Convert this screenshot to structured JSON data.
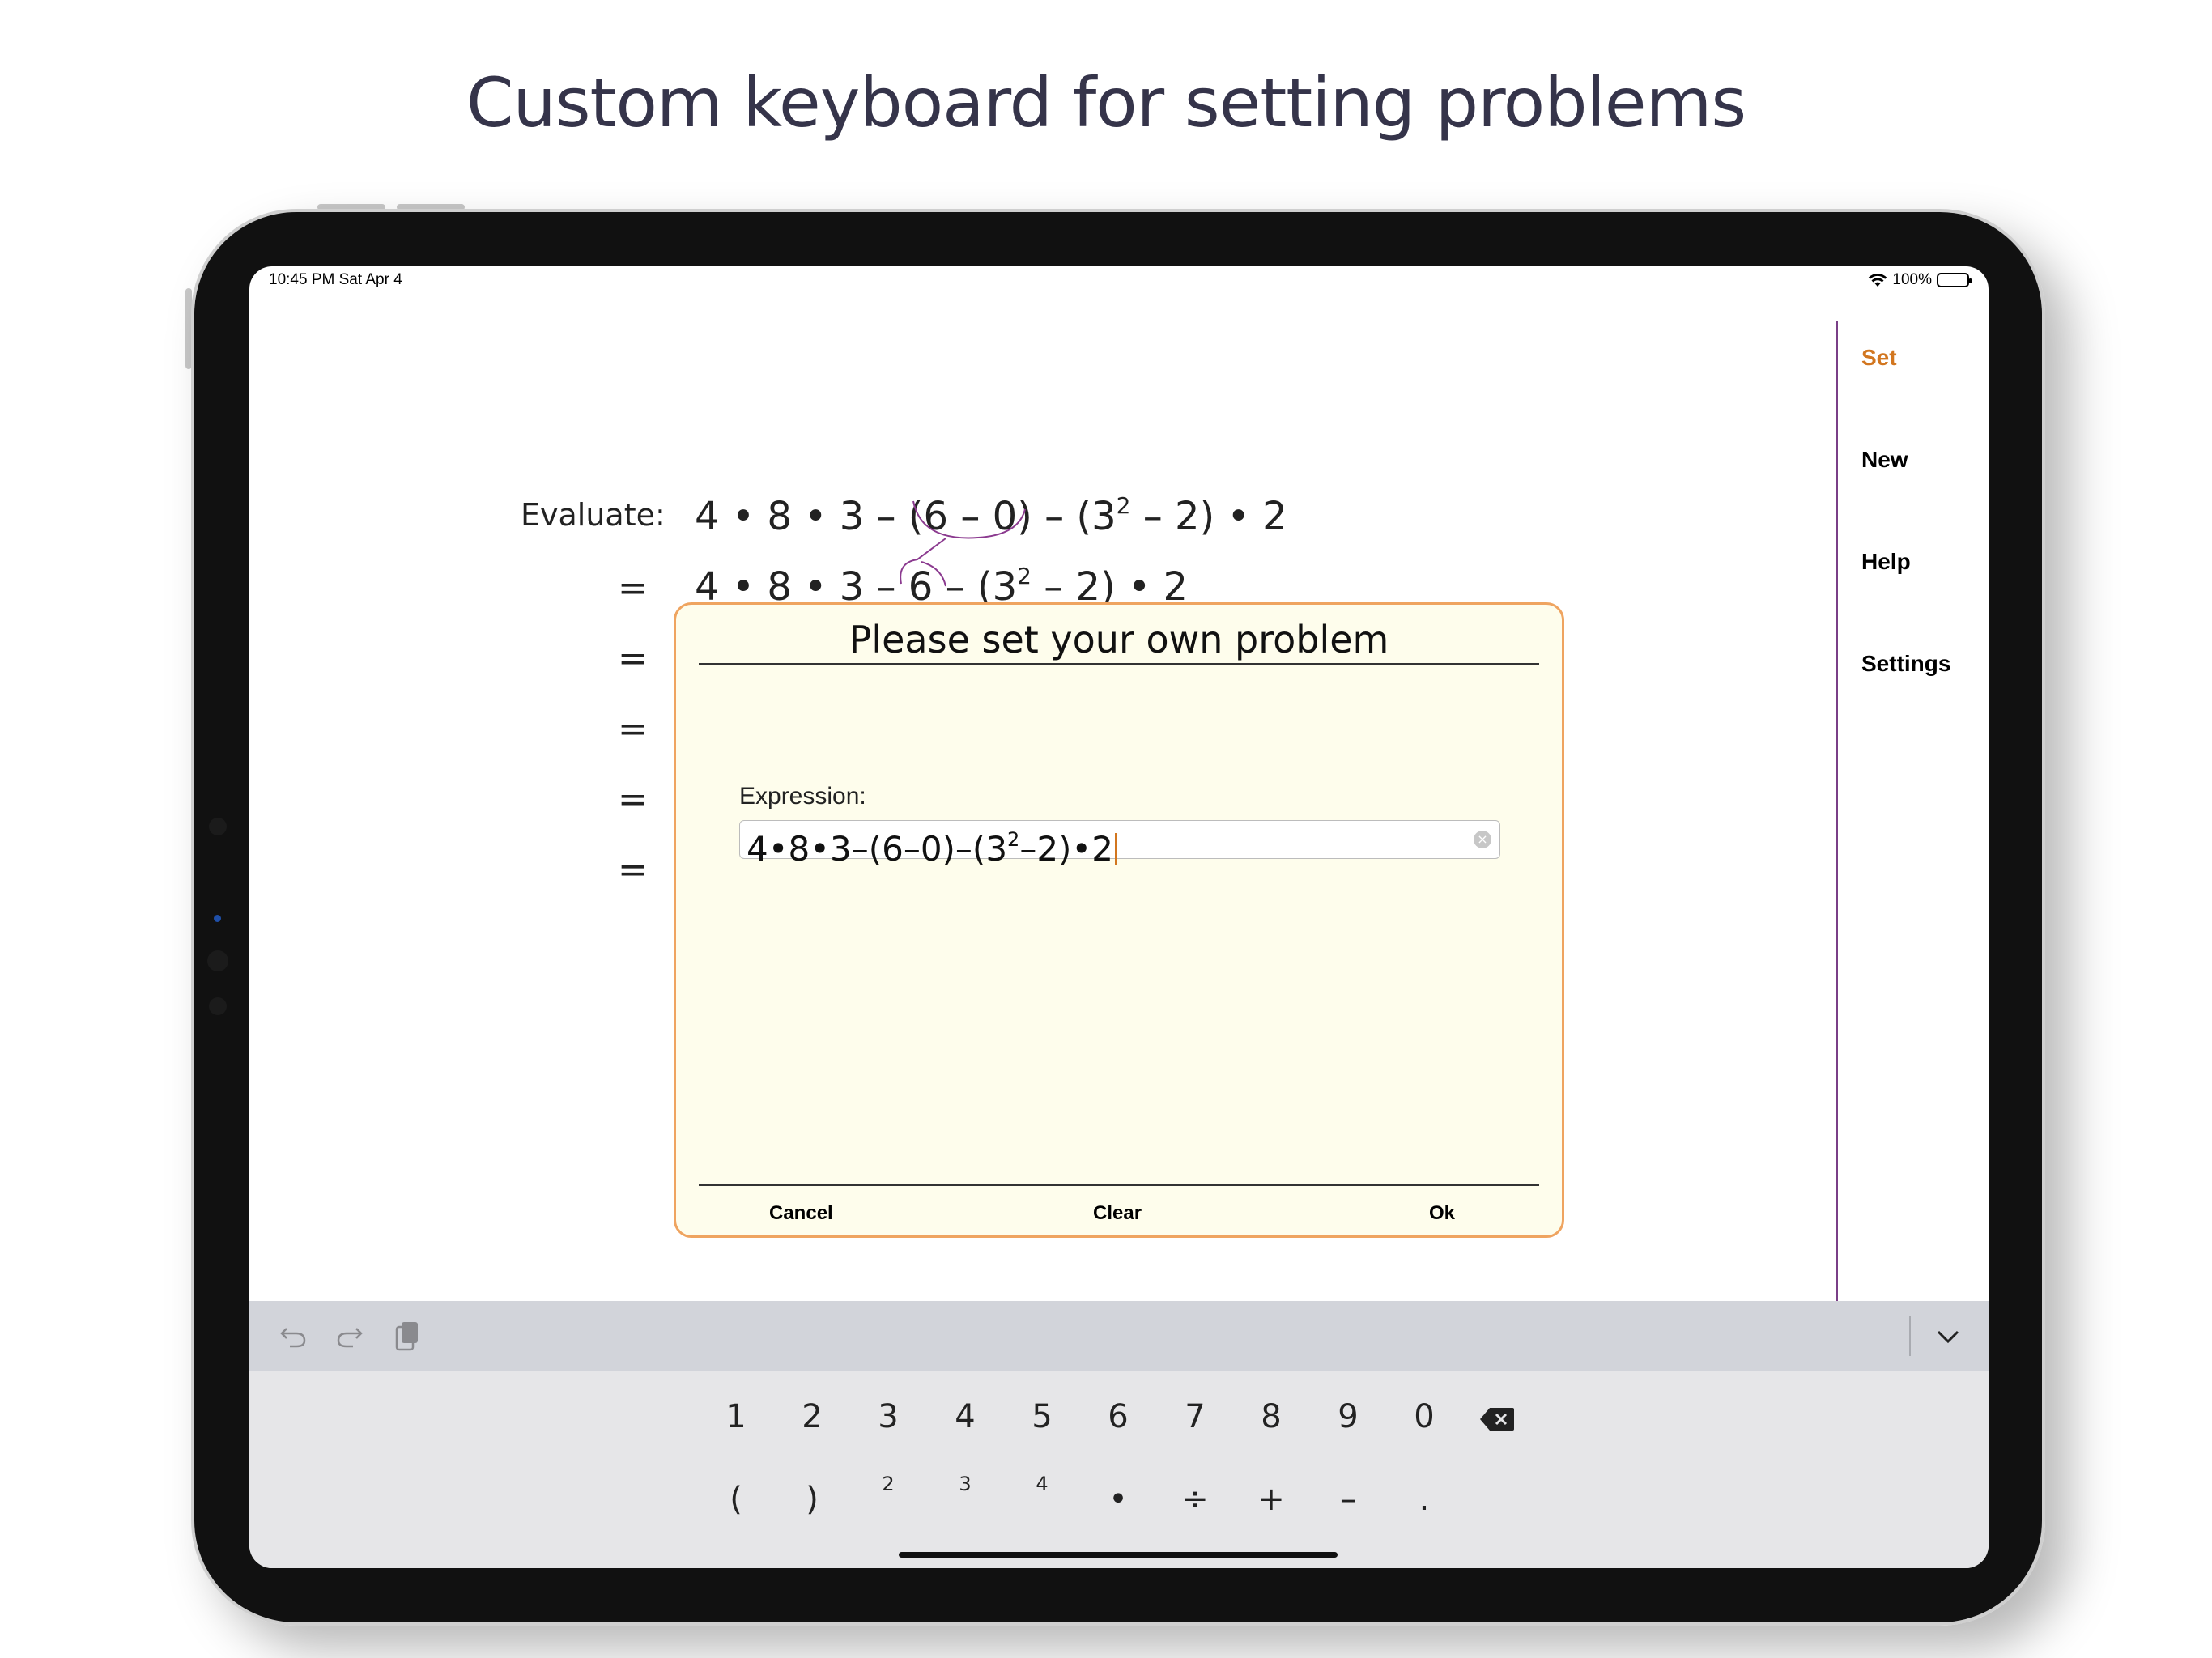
{
  "headline": "Custom keyboard for setting problems",
  "status": {
    "time": "10:45 PM   Sat Apr 4",
    "battery": "100%"
  },
  "sidebar": {
    "items": [
      {
        "label": "Set",
        "active": true
      },
      {
        "label": "New"
      },
      {
        "label": "Help"
      },
      {
        "label": "Settings"
      }
    ]
  },
  "problem": {
    "label": "Evaluate:",
    "line1": {
      "a": "4 • 8 • 3 – (6 – 0) – (3",
      "exp": "2",
      "b": " – 2) • 2"
    },
    "line2": {
      "a": "4 • 8 • 3 – 6 – (3",
      "exp": "2",
      "b": " – 2) • 2"
    },
    "equals": [
      "=",
      "=",
      "=",
      "=",
      "="
    ]
  },
  "dialog": {
    "title": "Please set your own problem",
    "expression_label": "Expression:",
    "expression": {
      "a": "4•8•3–(6–0)–(3",
      "exp": "2",
      "b": "–2)•2"
    },
    "buttons": {
      "cancel": "Cancel",
      "clear": "Clear",
      "ok": "Ok"
    }
  },
  "keyboard": {
    "row1": [
      "1",
      "2",
      "3",
      "4",
      "5",
      "6",
      "7",
      "8",
      "9",
      "0"
    ],
    "row2": [
      "(",
      ")",
      "•",
      "÷",
      "+",
      "–",
      "."
    ],
    "superscripts": [
      "2",
      "3",
      "4"
    ],
    "icons": [
      "undo-icon",
      "redo-icon",
      "paste-icon",
      "backspace-icon",
      "chevron-down-icon"
    ]
  },
  "colors": {
    "accent": "#d2761f",
    "dialog_border": "#efa460",
    "dialog_bg": "#fefdec",
    "sidebar_line": "#7a3f87"
  }
}
